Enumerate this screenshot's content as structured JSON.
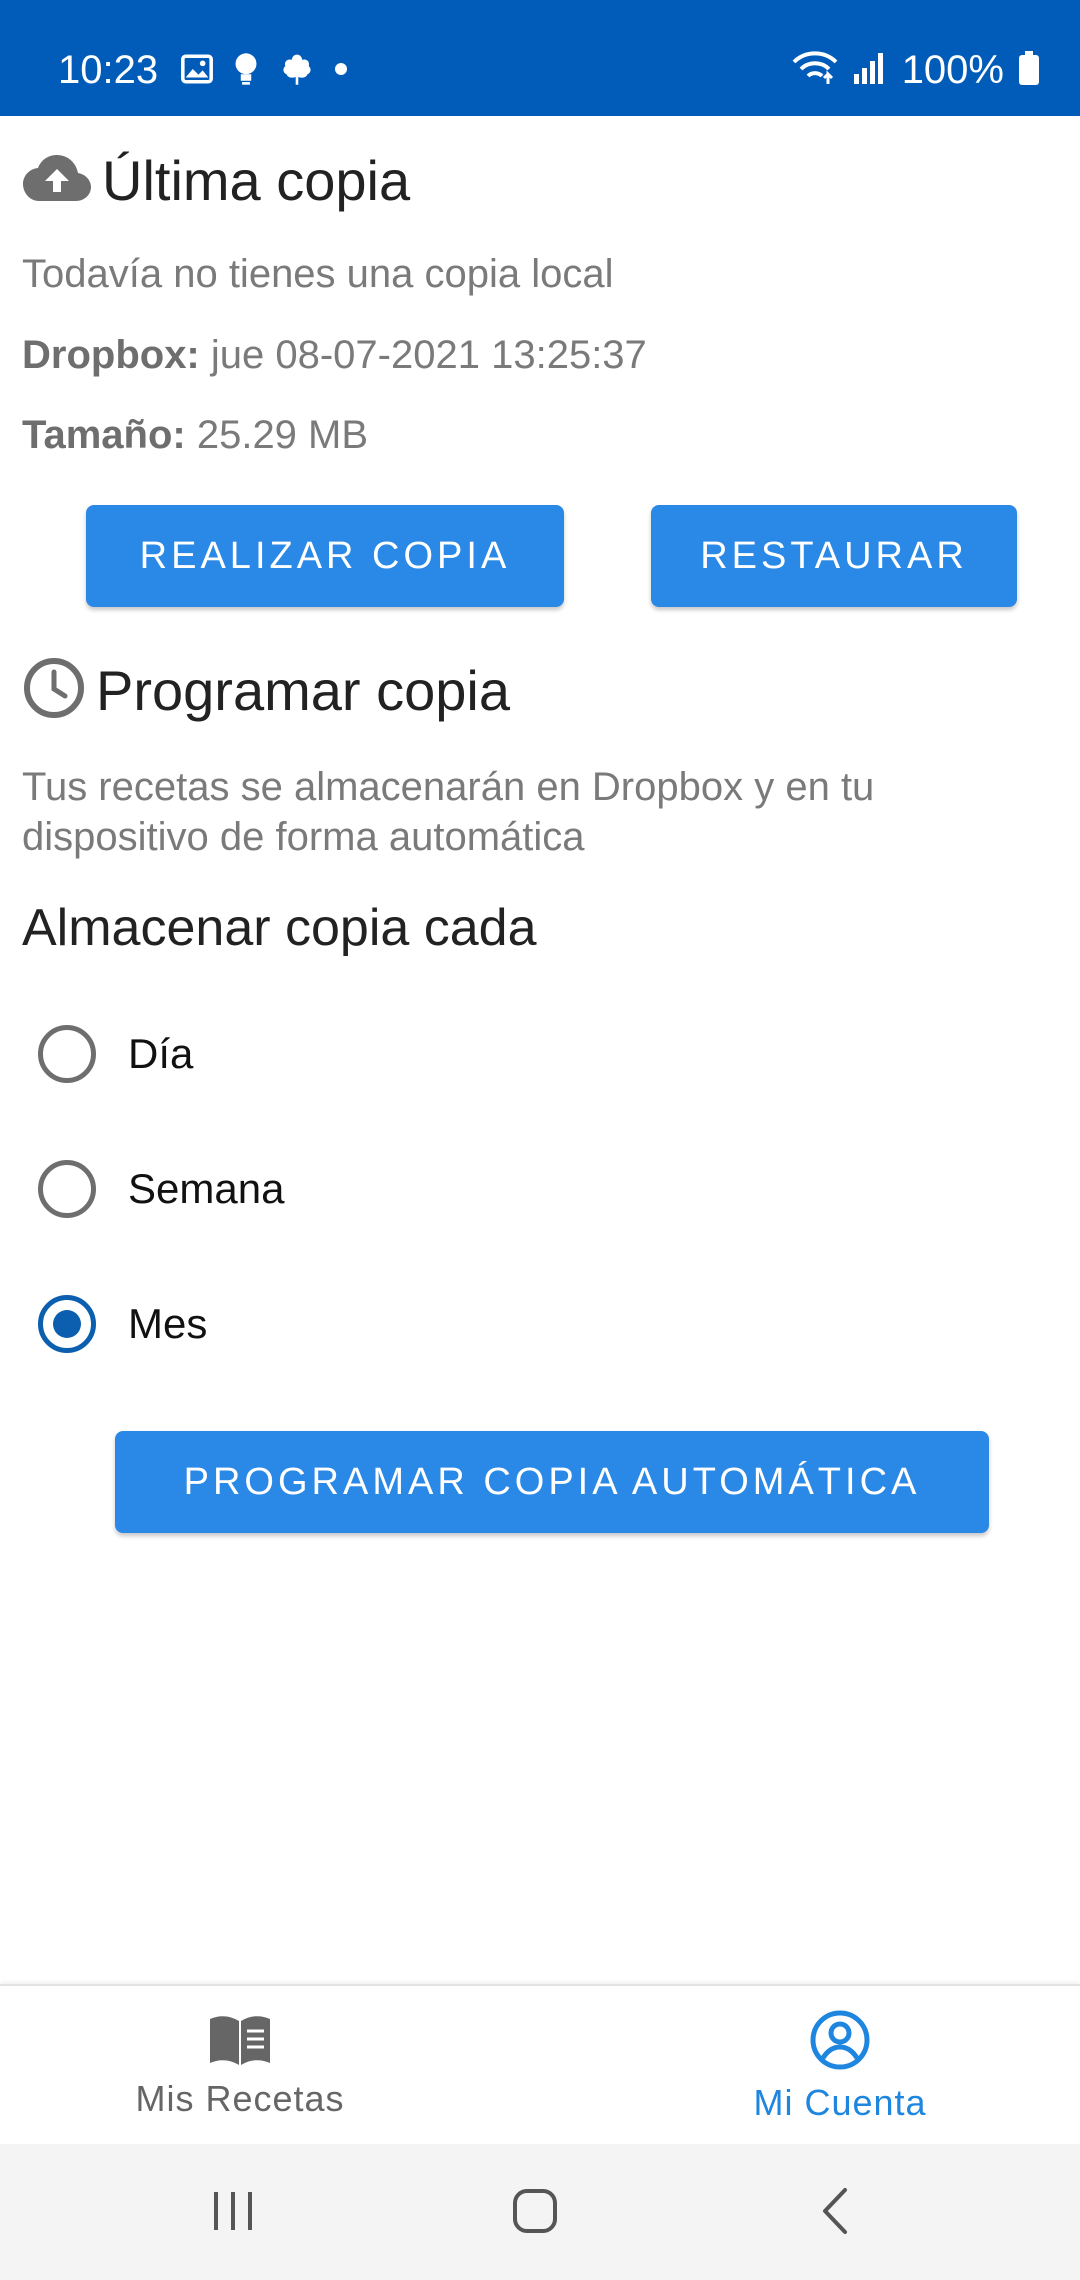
{
  "status_bar": {
    "time": "10:23",
    "battery": "100%",
    "icons": [
      "image-icon",
      "bulb-icon",
      "tree-icon",
      "dot-icon",
      "wifi-icon",
      "signal-icon",
      "battery-icon"
    ]
  },
  "last_backup": {
    "title": "Última copia",
    "icon": "cloud-upload-icon",
    "local_status": "Todavía no tienes una copia local",
    "dropbox_label": "Dropbox:",
    "dropbox_value": " jue 08-07-2021 13:25:37",
    "size_label": "Tamaño:",
    "size_value": " 25.29 MB",
    "backup_button": "REALIZAR COPIA",
    "restore_button": "RESTAURAR"
  },
  "schedule": {
    "title": "Programar copia",
    "icon": "clock-icon",
    "description": "Tus recetas se almacenarán en Dropbox y en tu dispositivo de forma automática",
    "frequency_title": "Almacenar copia cada",
    "options": [
      {
        "label": "Día",
        "selected": false
      },
      {
        "label": "Semana",
        "selected": false
      },
      {
        "label": "Mes",
        "selected": true
      }
    ],
    "schedule_button": "PROGRAMAR COPIA AUTOMÁTICA"
  },
  "bottom_nav": {
    "items": [
      {
        "label": "Mis Recetas",
        "icon": "book-icon",
        "active": false
      },
      {
        "label": "Mi Cuenta",
        "icon": "account-icon",
        "active": true
      }
    ]
  },
  "colors": {
    "status_bar": "#005cb8",
    "button": "#2a88e6",
    "radio_selected": "#0b5fae",
    "nav_active": "#1f86e0"
  }
}
